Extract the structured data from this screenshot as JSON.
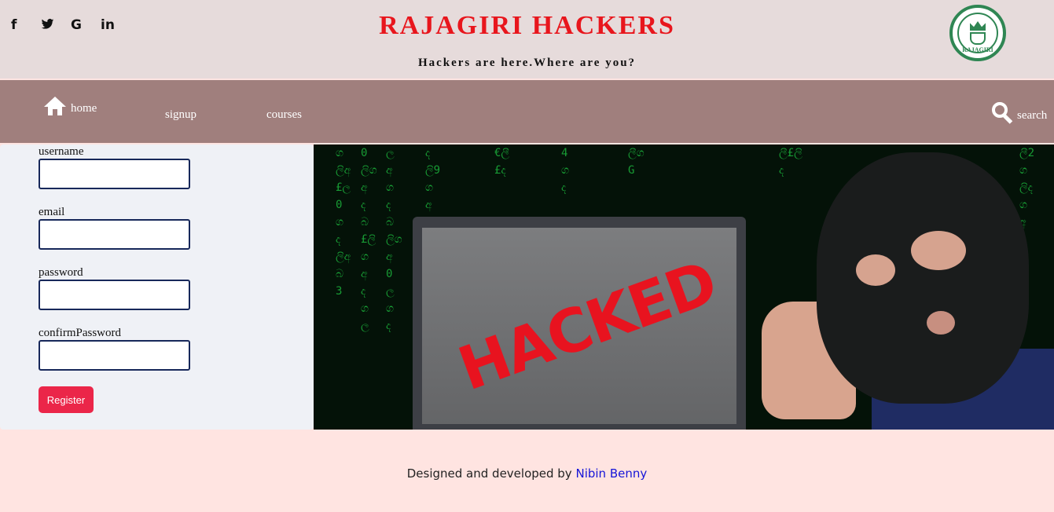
{
  "header": {
    "social": [
      {
        "icon": "facebook-icon",
        "glyph": "f"
      },
      {
        "icon": "twitter-icon",
        "glyph": "𝕥"
      },
      {
        "icon": "google-icon",
        "glyph": "G"
      },
      {
        "icon": "linkedin-icon",
        "glyph": "in"
      }
    ],
    "title": "RAJAGIRI HACKERS",
    "tagline": "Hackers are here.Where are you?",
    "logo_text": "RAJAGIRI"
  },
  "nav": {
    "home": "home",
    "signup": "signup",
    "courses": "courses",
    "search": "search"
  },
  "form": {
    "username_label": "username",
    "username_value": "",
    "email_label": "email",
    "email_value": "",
    "password_label": "password",
    "password_value": "",
    "confirm_label": "confirmPassword",
    "confirm_value": "",
    "register_label": "Register"
  },
  "hero": {
    "stamp_text": "HACKED"
  },
  "footer": {
    "text": "Designed and developed by",
    "author": "Nibin Benny"
  },
  "colors": {
    "title": "#e8161d",
    "header_bg": "#e6dbdb",
    "nav_bg": "#a07f7d",
    "register_bg": "#eb2649",
    "footer_bg": "#ffe4e1",
    "author_link": "#1515d8"
  }
}
